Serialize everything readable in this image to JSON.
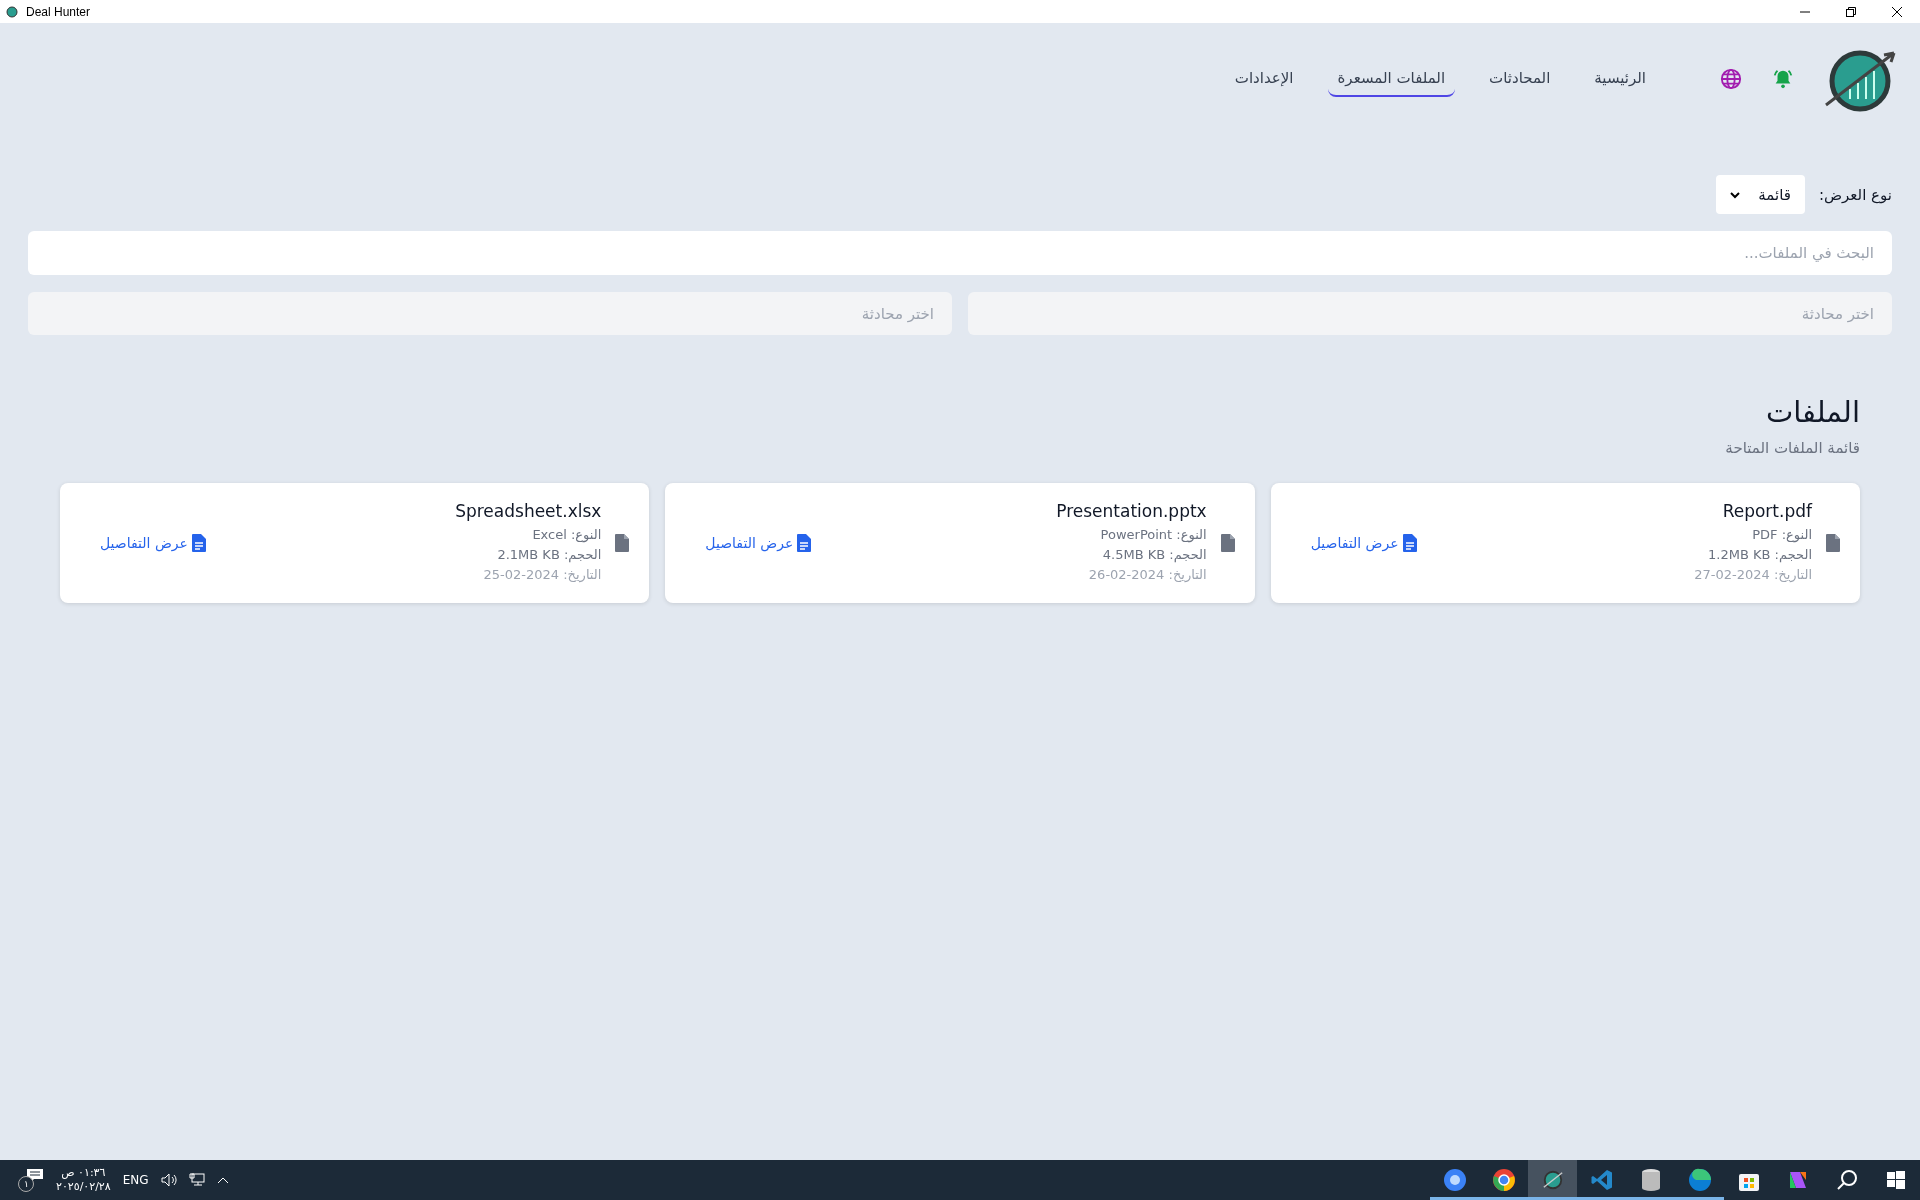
{
  "window": {
    "title": "Deal Hunter"
  },
  "nav": {
    "links": [
      {
        "label": "الرئيسية",
        "selected": false
      },
      {
        "label": "المحادثات",
        "selected": false
      },
      {
        "label": "الملفات المسعرة",
        "selected": true
      },
      {
        "label": "الإعدادات",
        "selected": false
      }
    ]
  },
  "view_type": {
    "label": "نوع العرض:",
    "value": "قائمة"
  },
  "search": {
    "placeholder": "البحث في الملفات..."
  },
  "conversation_selects": [
    {
      "placeholder": "اختر محادثة"
    },
    {
      "placeholder": "اختر محادثة"
    }
  ],
  "files_section": {
    "title": "الملفات",
    "subtitle": "قائمة الملفات المتاحة",
    "files": [
      {
        "name": "Report.pdf",
        "type_label": "النوع:",
        "type": "PDF",
        "size_label": "الحجم:",
        "size": "1.2MB KB",
        "date_label": "التاريخ:",
        "date": "27-02-2024",
        "details": "عرض التفاصيل"
      },
      {
        "name": "Presentation.pptx",
        "type_label": "النوع:",
        "type": "PowerPoint",
        "size_label": "الحجم:",
        "size": "4.5MB KB",
        "date_label": "التاريخ:",
        "date": "26-02-2024",
        "details": "عرض التفاصيل"
      },
      {
        "name": "Spreadsheet.xlsx",
        "type_label": "النوع:",
        "type": "Excel",
        "size_label": "الحجم:",
        "size": "2.1MB KB",
        "date_label": "التاريخ:",
        "date": "25-02-2024",
        "details": "عرض التفاصيل"
      }
    ]
  },
  "taskbar": {
    "notifications": "١",
    "time": "٠١:٣٦ ص",
    "date": "٢٠٢٥/٠٢/٢٨",
    "language": "ENG",
    "apps": [
      {
        "kind": "chromium",
        "running": true,
        "selected": false
      },
      {
        "kind": "chrome",
        "running": true,
        "selected": false
      },
      {
        "kind": "dealhunter",
        "running": true,
        "selected": true
      },
      {
        "kind": "code",
        "running": true,
        "selected": false
      },
      {
        "kind": "database",
        "running": true,
        "selected": false
      },
      {
        "kind": "edge",
        "running": true,
        "selected": false
      },
      {
        "kind": "store",
        "running": false,
        "selected": false
      },
      {
        "kind": "copilot",
        "running": false,
        "selected": false
      }
    ]
  }
}
